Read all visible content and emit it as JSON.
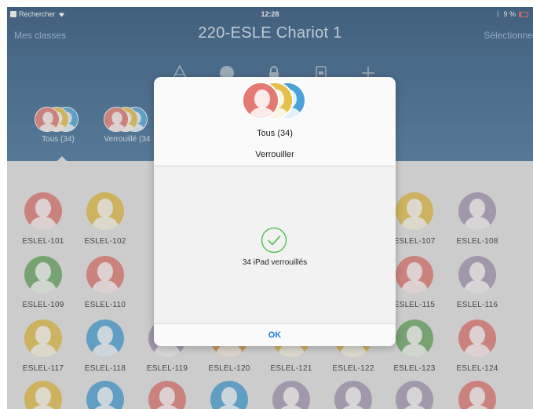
{
  "status_bar": {
    "carrier": "Rechercher",
    "time": "12:28",
    "battery": "9 %"
  },
  "nav": {
    "back_label": "Mes classes",
    "title": "220-ESLE Chariot 1",
    "select_label": "Sélectionne"
  },
  "toolbar": {
    "icons": [
      "apps-icon",
      "compass-icon",
      "lock-icon",
      "dock-icon",
      "plus-icon"
    ]
  },
  "groups": [
    {
      "label": "Tous (34)"
    },
    {
      "label": "Verrouillé (34"
    }
  ],
  "colors": {
    "red": "#e47a72",
    "yellow": "#e5c04a",
    "blue": "#4ba2d8",
    "green": "#6aa862",
    "purple": "#a69ab6",
    "orange": "#e49a4a",
    "accent": "#1f7fe0",
    "check": "#5cc15a"
  },
  "devices": [
    {
      "name": "ESLEL-101",
      "color": "red"
    },
    {
      "name": "ESLEL-102",
      "color": "yellow"
    },
    {
      "name": "ESLEL-107",
      "color": "yellow"
    },
    {
      "name": "ESLEL-108",
      "color": "purple"
    },
    {
      "name": "ESLEL-109",
      "color": "green"
    },
    {
      "name": "ESLEL-110",
      "color": "red"
    },
    {
      "name": "ESLEL-115",
      "color": "red"
    },
    {
      "name": "ESLEL-116",
      "color": "purple"
    },
    {
      "name": "ESLEL-117",
      "color": "yellow"
    },
    {
      "name": "ESLEL-118",
      "color": "blue"
    },
    {
      "name": "ESLEL-119",
      "color": "purple"
    },
    {
      "name": "ESLEL-120",
      "color": "orange"
    },
    {
      "name": "ESLEL-121",
      "color": "yellow"
    },
    {
      "name": "ESLEL-122",
      "color": "yellow"
    },
    {
      "name": "ESLEL-123",
      "color": "green"
    },
    {
      "name": "ESLEL-124",
      "color": "red"
    }
  ],
  "bottom_row_colors": [
    "yellow",
    "blue",
    "red",
    "blue",
    "purple",
    "purple",
    "purple",
    "red"
  ],
  "modal": {
    "group_label": "Tous (34)",
    "action_label": "Verrouiller",
    "message": "34 iPad verrouillés",
    "ok_label": "OK"
  }
}
